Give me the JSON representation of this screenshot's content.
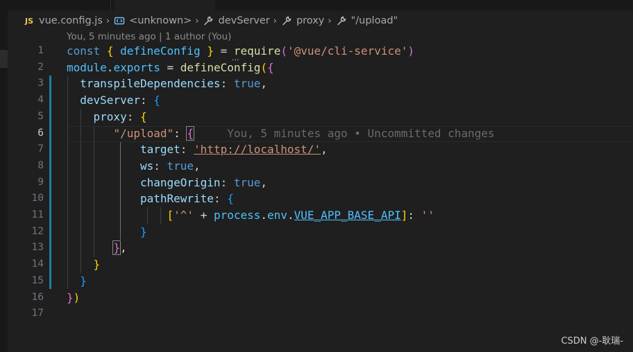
{
  "breadcrumb": {
    "file_badge": "JS",
    "file": "vue.config.js",
    "items": [
      "<unknown>",
      "devServer",
      "proxy",
      "\"/upload\""
    ],
    "sep": "›"
  },
  "blame": {
    "header": "You, 5 minutes ago | 1 author (You)",
    "inline": "You, 5 minutes ago • Uncommitted changes"
  },
  "editor": {
    "active_line": 6,
    "codelens_dots": "...",
    "line_numbers": [
      "1",
      "2",
      "3",
      "4",
      "5",
      "6",
      "7",
      "8",
      "9",
      "10",
      "11",
      "12",
      "13",
      "14",
      "15",
      "16",
      "17"
    ],
    "tokens": {
      "const": "const",
      "defineConfig": "defineConfig",
      "equals": "=",
      "require": "require",
      "cli_service": "'@vue/cli-service'",
      "module": "module",
      "exports": "exports",
      "transpileDependencies": "transpileDependencies",
      "true": "true",
      "devServer": "devServer",
      "proxy": "proxy",
      "upload": "\"/upload\"",
      "target": "target",
      "target_value": "'http://localhost/'",
      "ws": "ws",
      "changeOrigin": "changeOrigin",
      "pathRewrite": "pathRewrite",
      "caret": "'^'",
      "plus": "+",
      "process": "process",
      "env": "env",
      "base_api": "VUE_APP_BASE_API",
      "empty_string": "''"
    }
  },
  "watermark": "CSDN @-耿瑞-",
  "colors": {
    "background": "#1f1f1f",
    "keyword": "#569cd6",
    "property": "#9cdcfe",
    "function": "#dcdcaa",
    "string": "#ce9178",
    "bracket_gold": "#ffd700",
    "bracket_orchid": "#da70d6",
    "bracket_blue": "#179fff",
    "modified_gutter": "#1b81a8"
  },
  "icons": [
    "js-file-icon",
    "symbol-namespace-icon",
    "wrench-icon",
    "chevron-right-icon"
  ]
}
